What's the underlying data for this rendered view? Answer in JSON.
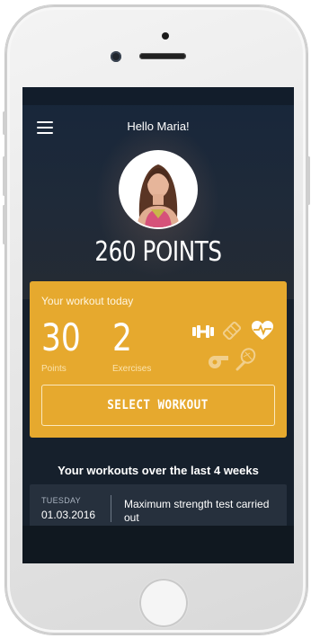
{
  "header": {
    "greeting": "Hello Maria!",
    "total_points": "260 POINTS"
  },
  "workout_today": {
    "title": "Your workout today",
    "points_value": "30",
    "points_label": "Points",
    "exercises_value": "2",
    "exercises_label": "Exercises",
    "equipment_icons": [
      {
        "name": "dumbbell-icon",
        "active": true
      },
      {
        "name": "yoga-mat-icon",
        "active": false
      },
      {
        "name": "heart-rate-icon",
        "active": true
      },
      {
        "name": "whistle-icon",
        "active": false
      },
      {
        "name": "tennis-racket-icon",
        "active": false
      }
    ],
    "select_button": "SELECT WORKOUT"
  },
  "history": {
    "heading": "Your workouts over the last 4 weeks",
    "items": [
      {
        "day": "TUESDAY",
        "date": "01.03.2016",
        "description": "Maximum strength test carried out"
      }
    ]
  },
  "colors": {
    "accent": "#e6a92e",
    "background": "#16202c",
    "row": "#26303d"
  }
}
